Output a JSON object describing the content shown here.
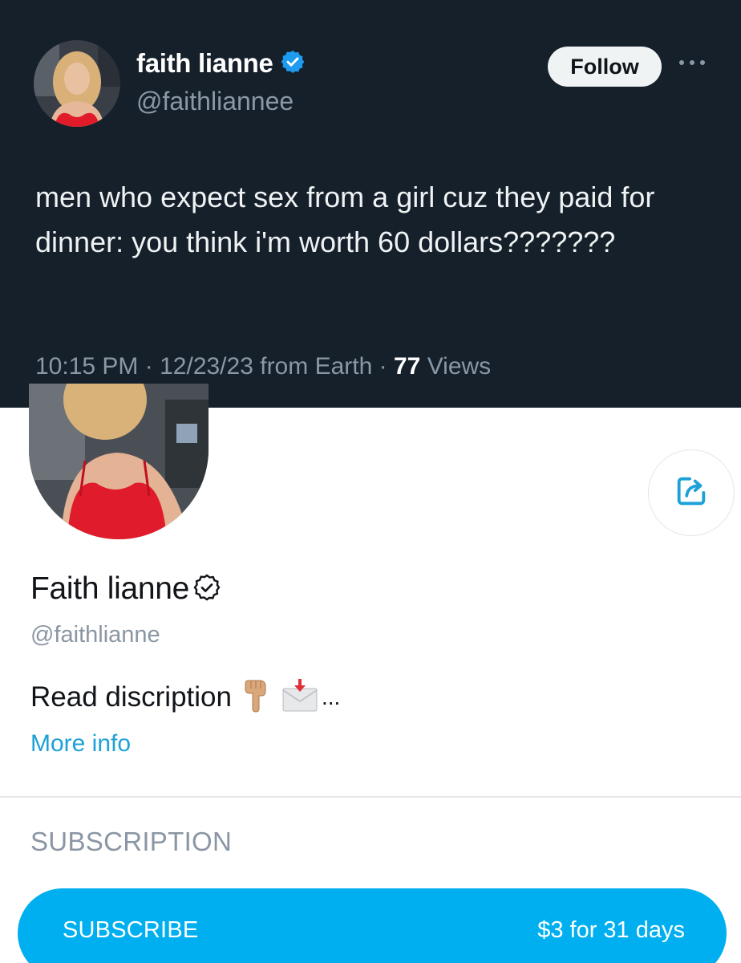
{
  "tweet": {
    "author_name": "faith lianne",
    "author_handle": "@faithliannee",
    "follow_label": "Follow",
    "text": "men who expect sex from a girl cuz they paid for dinner: you think i'm worth 60 dollars???????",
    "time": "10:15 PM",
    "date": "12/23/23",
    "source": "from Earth",
    "views_count": "77",
    "views_label": "Views",
    "separator": "·"
  },
  "profile": {
    "name": "Faith lianne",
    "handle": "@faithlianne",
    "bio": "Read discription",
    "bio_ellipsis": "...",
    "more_info_label": "More info"
  },
  "subscription": {
    "section_title": "SUBSCRIPTION",
    "button_label": "SUBSCRIBE",
    "price": "$3 for 31 days"
  },
  "icons": {
    "verified": "verified-badge-icon",
    "more": "more-dots-icon",
    "share": "share-icon",
    "profile_verified": "verified-outline-icon",
    "bio_emoji_1": "backhand-index-pointing-down-icon",
    "bio_emoji_2": "envelope-with-arrow-icon"
  },
  "colors": {
    "tweet_bg": "#15202b",
    "verified_blue": "#1d9bf0",
    "accent": "#00aff0",
    "link": "#1da1d6"
  }
}
